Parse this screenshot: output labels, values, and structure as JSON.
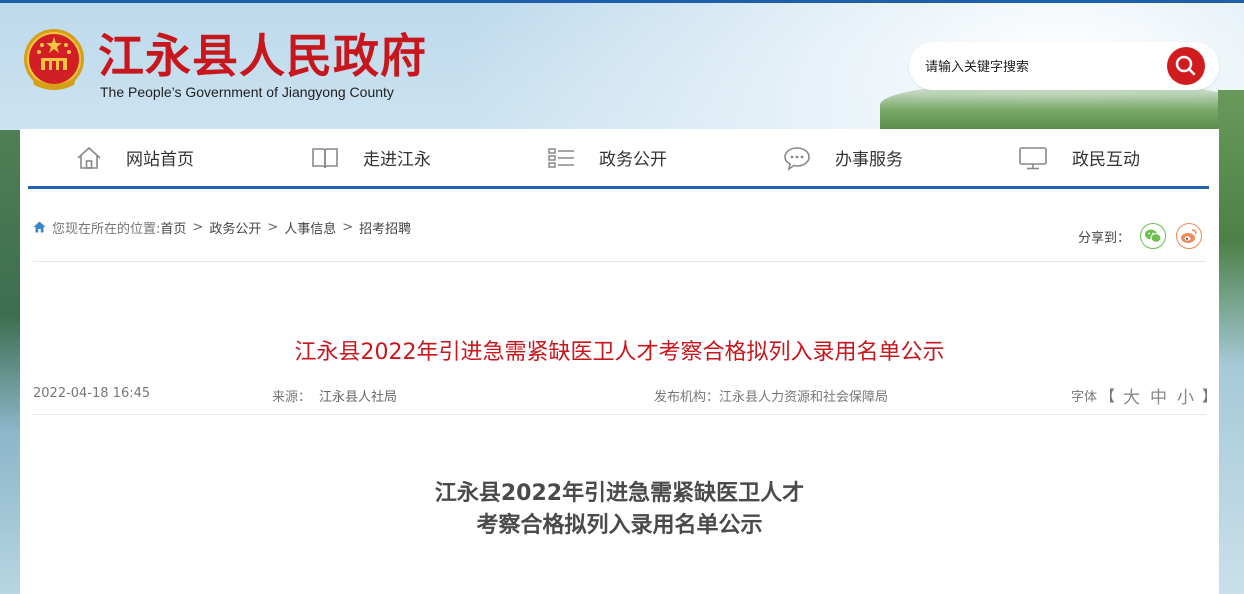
{
  "header": {
    "site_title": "江永县人民政府",
    "site_subtitle": "The People’s Government of Jiangyong County",
    "emblem_icon": "national-emblem-icon",
    "search": {
      "placeholder": "请输入关键字搜索",
      "button_icon": "search-icon"
    }
  },
  "nav": {
    "items": [
      {
        "label": "网站首页",
        "icon": "home-icon"
      },
      {
        "label": "走进江永",
        "icon": "book-icon"
      },
      {
        "label": "政务公开",
        "icon": "list-icon"
      },
      {
        "label": "办事服务",
        "icon": "chat-icon"
      },
      {
        "label": "政民互动",
        "icon": "monitor-icon"
      }
    ]
  },
  "breadcrumb": {
    "prefix": "您现在所在的位置:",
    "items": [
      "首页",
      "政务公开",
      "人事信息",
      "招考招聘"
    ],
    "separator": ">"
  },
  "share": {
    "label": "分享到：",
    "targets": [
      "wechat-icon",
      "weibo-icon"
    ]
  },
  "article": {
    "title": "江永县2022年引进急需紧缺医卫人才考察合格拟列入录用名单公示",
    "date": "2022-04-18 16:45",
    "source_label": "来源：",
    "source_value": "江永县人社局",
    "publisher_label": "发布机构：",
    "publisher_value": "江永县人力资源和社会保障局",
    "font_label": "字体",
    "font_bracket_open": "【",
    "font_options": [
      "大",
      "中",
      "小"
    ],
    "font_bracket_close": "】",
    "content_title_line1": "江永县2022年引进急需紧缺医卫人才",
    "content_title_line2": "考察合格拟列入录用名单公示"
  },
  "colors": {
    "brand_red": "#c8161d",
    "nav_underline": "#1d65b3",
    "search_button": "#d01c1f"
  }
}
